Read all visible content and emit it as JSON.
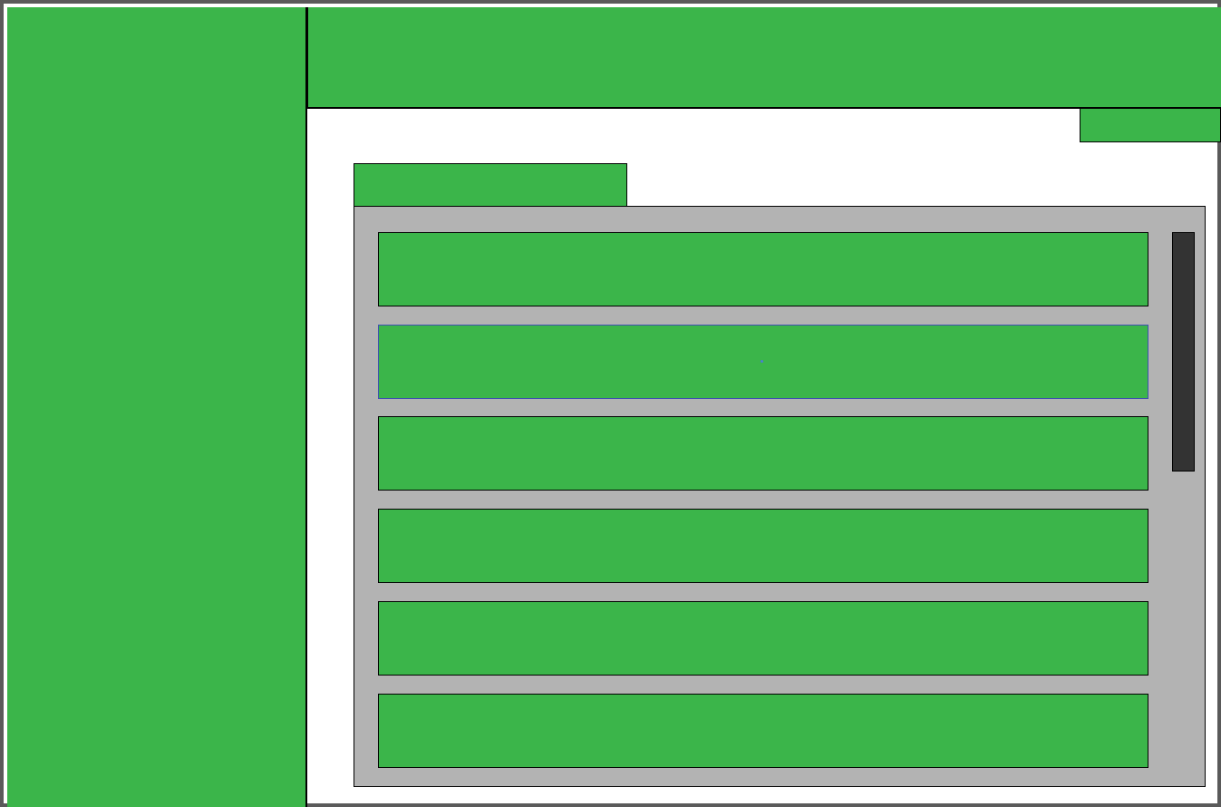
{
  "colors": {
    "panel_fill": "#3bb54a",
    "list_background": "#b3b3b3",
    "page_background": "#ffffff",
    "frame": "#5a5a5a",
    "scrollbar_thumb": "#333333",
    "selection_border": "#3d4fb0",
    "selection_dot": "#4a7fd0"
  },
  "list": {
    "item_count": 6,
    "selected_index": 1,
    "items": [
      {
        "label": ""
      },
      {
        "label": ""
      },
      {
        "label": ""
      },
      {
        "label": ""
      },
      {
        "label": ""
      },
      {
        "label": ""
      }
    ]
  },
  "scrollbar": {
    "visible_fraction": 0.41
  }
}
